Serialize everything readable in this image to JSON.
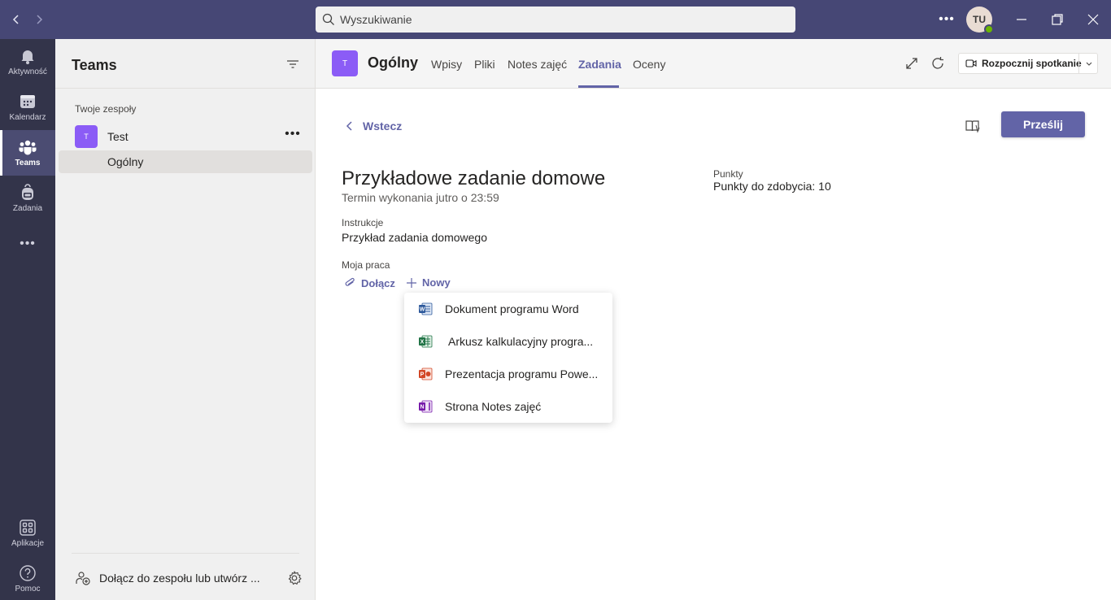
{
  "titlebar": {
    "search_placeholder": "Wyszukiwanie",
    "avatar_initials": "TU"
  },
  "rail": {
    "items": [
      {
        "label": "Aktywność",
        "icon": "bell-icon"
      },
      {
        "label": "Kalendarz",
        "icon": "calendar-icon"
      },
      {
        "label": "Teams",
        "icon": "teams-icon"
      },
      {
        "label": "Zadania",
        "icon": "backpack-icon"
      },
      {
        "label": "Aplikacje",
        "icon": "apps-icon"
      },
      {
        "label": "Pomoc",
        "icon": "help-icon"
      }
    ],
    "active": "Teams"
  },
  "panel": {
    "title": "Teams",
    "section_label": "Twoje zespoły",
    "team": {
      "avatar": "T",
      "name": "Test"
    },
    "channel": "Ogólny",
    "join_label": "Dołącz do zespołu lub utwórz ..."
  },
  "channel_header": {
    "avatar": "T",
    "title": "Ogólny",
    "tabs": [
      "Wpisy",
      "Pliki",
      "Notes zajęć",
      "Zadania",
      "Oceny"
    ],
    "active_tab": "Zadania",
    "meet_label": "Rozpocznij spotkanie"
  },
  "assignment": {
    "back_label": "Wstecz",
    "submit_label": "Prześlij",
    "title": "Przykładowe zadanie domowe",
    "due": "Termin wykonania jutro o 23:59",
    "points_label": "Punkty",
    "points_value": "Punkty do zdobycia: 10",
    "instructions_label": "Instrukcje",
    "instructions_value": "Przykład zadania domowego",
    "my_work_label": "Moja praca",
    "attach_label": "Dołącz",
    "new_label": "Nowy"
  },
  "new_menu": {
    "items": [
      {
        "label": "Dokument programu Word",
        "icon": "word-icon",
        "color": "#2b579a"
      },
      {
        "label": "Arkusz kalkulacyjny progra...",
        "icon": "excel-icon",
        "color": "#217346"
      },
      {
        "label": "Prezentacja programu Powe...",
        "icon": "powerpoint-icon",
        "color": "#d24726"
      },
      {
        "label": "Strona Notes zajęć",
        "icon": "onenote-icon",
        "color": "#7719aa"
      }
    ]
  },
  "colors": {
    "brand": "#6264a7",
    "titlebar": "#464775",
    "rail": "#33344a"
  }
}
